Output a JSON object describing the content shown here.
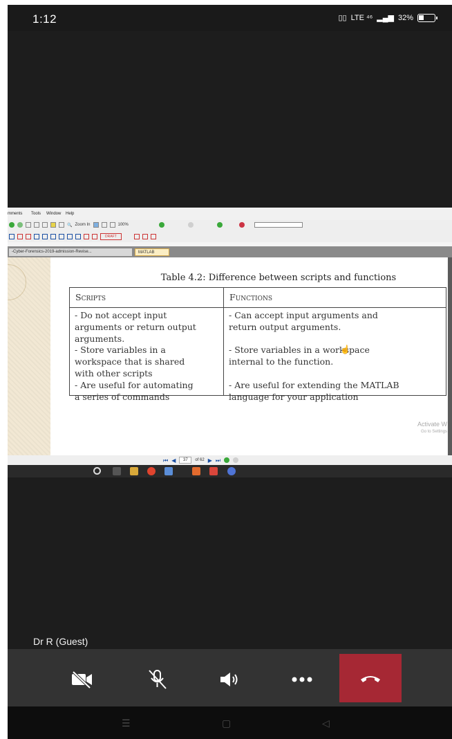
{
  "status_bar": {
    "time": "1:12",
    "battery": "32%",
    "signal_text": "LTE ⁴⁶"
  },
  "shared_screen": {
    "menu": [
      "mments",
      "Tools",
      "Window",
      "Help"
    ],
    "zoom_label": "Zoom In",
    "zoom_percent": "100%",
    "draft_label": "DRAFT",
    "tabs": [
      {
        "label": "-Cyber-Forensics-2019-admission-Revise..."
      },
      {
        "label": "MATLAB"
      }
    ],
    "table": {
      "caption": "Table 4.2: Difference between scripts and functions",
      "headers": [
        "Scripts",
        "Functions"
      ],
      "scripts_lines": [
        "- Do not accept input",
        "arguments or return output",
        "arguments.",
        "- Store variables in a",
        "workspace that is shared",
        "with other scripts",
        "- Are useful for automating",
        "a series of commands"
      ],
      "functions_lines": [
        "- Can accept input arguments and",
        "return output arguments.",
        "",
        "- Store variables in a workspace",
        "internal to the function.",
        "",
        "- Are useful for extending the MATLAB",
        "language for your application"
      ]
    },
    "watermark": {
      "title": "Activate W",
      "sub": "Go to Settings"
    },
    "page_nav": {
      "current": "37",
      "total": "of 62"
    }
  },
  "call": {
    "participant_name": "Dr R (Guest)",
    "controls": {
      "camera": "camera-off",
      "mic": "mic-off",
      "speaker": "speaker",
      "more": "more",
      "end": "end-call"
    },
    "end_call_color": "#a62834"
  },
  "colors": {
    "background": "#1d1d1d",
    "control_bar": "#333333"
  }
}
